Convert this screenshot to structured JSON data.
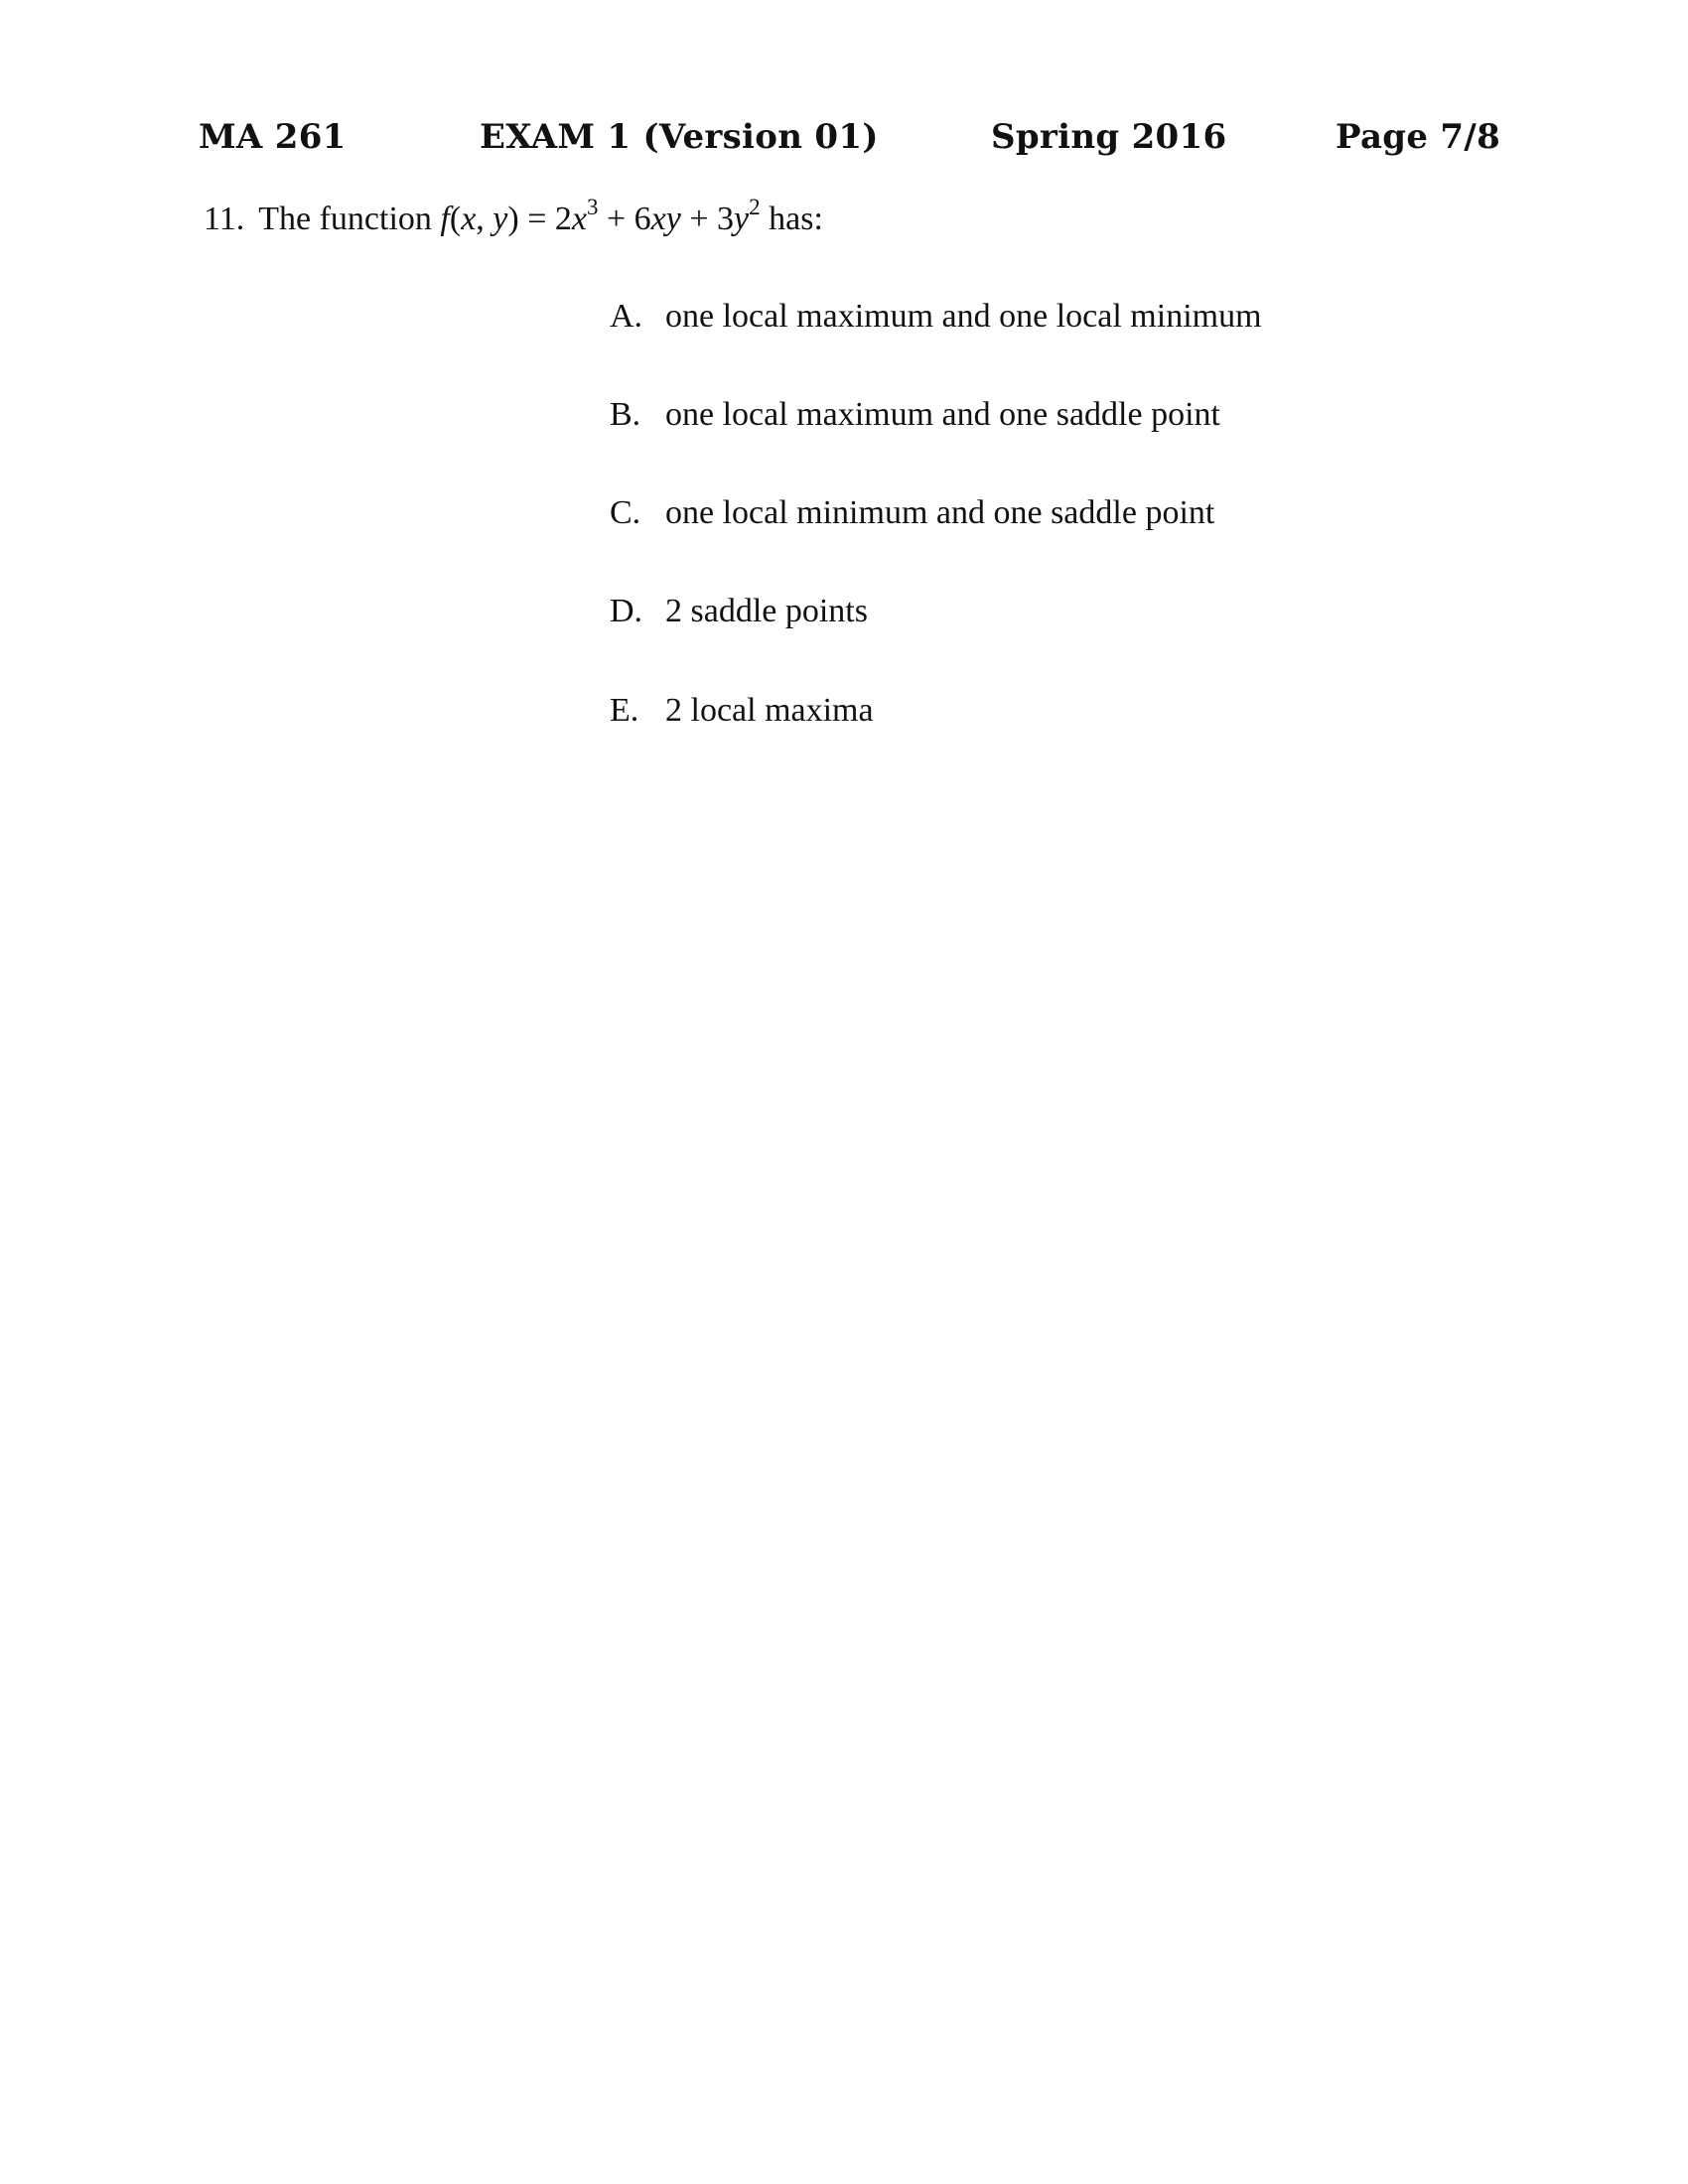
{
  "header": {
    "course": "MA 261",
    "exam": "EXAM 1 (Version 01)",
    "term": "Spring 2016",
    "page": "Page 7/8"
  },
  "question": {
    "number": "11.",
    "prefix": "The function",
    "suffix": "has:",
    "function_latex": "f(x,y) = 2x^3 + 6xy + 3y^2"
  },
  "choices": [
    {
      "letter": "A.",
      "text": "one local maximum and one local minimum"
    },
    {
      "letter": "B.",
      "text": "one local maximum and one saddle point"
    },
    {
      "letter": "C.",
      "text": "one local minimum and one saddle point"
    },
    {
      "letter": "D.",
      "text": "2 saddle points"
    },
    {
      "letter": "E.",
      "text": "2 local maxima"
    }
  ]
}
